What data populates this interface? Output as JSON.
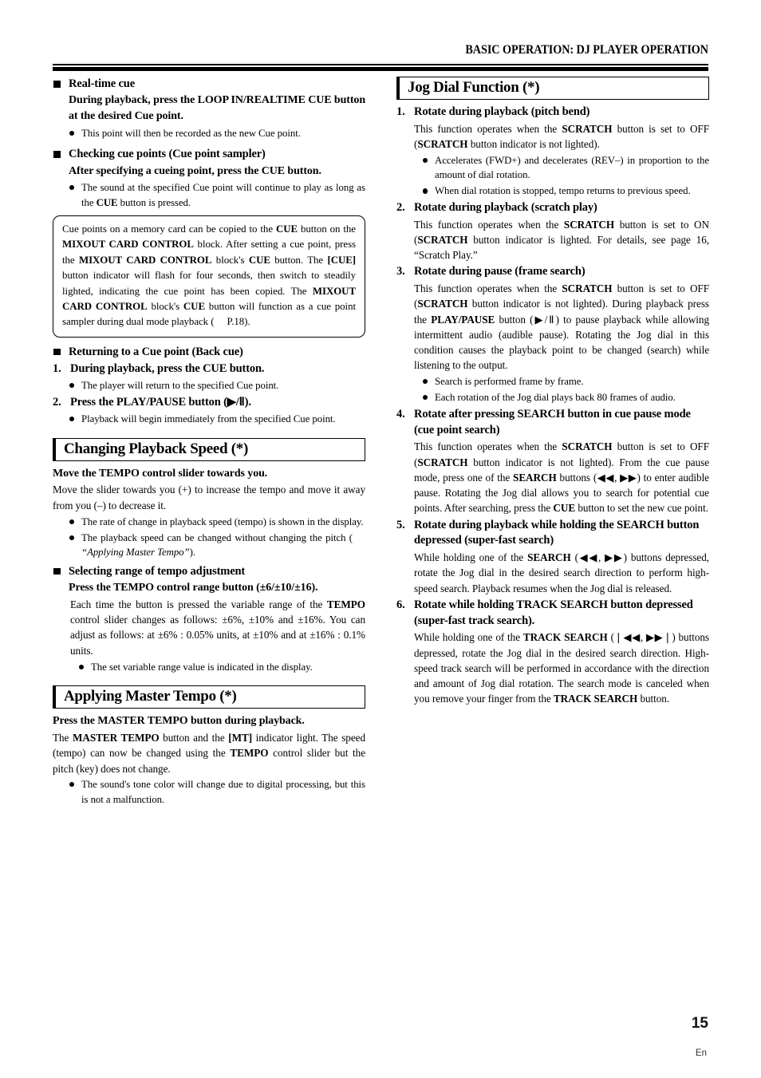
{
  "header": {
    "title": "BASIC OPERATION: DJ PLAYER OPERATION"
  },
  "footer": {
    "page_number": "15",
    "language": "En"
  },
  "left_column": {
    "realtime_cue": {
      "heading": "Real-time cue",
      "instruction_part1": "During playback, press the ",
      "instruction_bold": "LOOP IN/REALTIME CUE",
      "instruction_part2": " button at the desired Cue point.",
      "bullet1": "This point will then be recorded as the new Cue point."
    },
    "checking_cue_points": {
      "heading": "Checking cue points (Cue point sampler)",
      "instruction": "After specifying a cueing point, press the CUE button.",
      "bullet1_part1": "The sound at the specified Cue point will continue to play as long as the ",
      "bullet1_bold": "CUE",
      "bullet1_part2": " button is pressed."
    },
    "note": {
      "t1": "Cue points on a memory card can be copied to the ",
      "b1": "CUE",
      "t2": " button on the ",
      "b2": "MIXOUT CARD CONTROL",
      "t3": " block. After setting a cue point, press the ",
      "b3": "MIXOUT CARD CONTROL",
      "t4": " block's ",
      "b4": "CUE",
      "t5": " button. The ",
      "b5": "[CUE]",
      "t6": " button indicator will flash for four seconds, then switch to steadily lighted, indicating the cue point has been copied. The ",
      "b6": "MIXOUT CARD CONTROL",
      "t7": " block's ",
      "b7": "CUE",
      "t8": " button will function as a cue point sampler during dual mode playback (",
      "t9": "P.18)."
    },
    "back_cue": {
      "heading": "Returning to a Cue point (Back cue)",
      "step1_num": "1.",
      "step1_text": "During playback, press the CUE button.",
      "step1_bullet": "The player will return to the specified Cue point.",
      "step2_num": "2.",
      "step2_text": "Press the PLAY/PAUSE button (▶/Ⅱ).",
      "step2_bullet": "Playback will begin immediately from the specified Cue point."
    },
    "changing_playback_speed": {
      "section_title": "Changing Playback Speed (*)",
      "instruction": "Move the TEMPO control slider towards you.",
      "body": "Move the slider towards you (+) to increase the tempo and move it away from you (–) to decrease it.",
      "bullet1": "The rate of change in playback speed (tempo) is shown in the display.",
      "bullet2_part1": "The playback speed can be changed without changing the pitch (",
      "bullet2_italic": "“Applying Master Tempo”",
      "bullet2_part2": ").",
      "sub_heading": "Selecting range of tempo adjustment",
      "sub_instruction": "Press the TEMPO control range button (±6/±10/±16).",
      "sub_body_part1": "Each time the button is pressed the variable range of the ",
      "sub_body_bold": "TEMPO",
      "sub_body_part2": " control slider changes as follows: ±6%, ±10% and ±16%.  You can adjust as follows: at ±6% : 0.05% units, at ±10% and at ±16% : 0.1% units.",
      "sub_bullet": "The set variable range value is indicated in the display."
    },
    "applying_master_tempo": {
      "section_title": "Applying Master Tempo (*)",
      "instruction": "Press the MASTER TEMPO button during playback.",
      "body_t1": "The ",
      "body_b1": "MASTER TEMPO",
      "body_t2": " button and the ",
      "body_b2": "[MT]",
      "body_t3": " indicator light. The speed (tempo) can now be changed using the ",
      "body_b3": "TEMPO",
      "body_t4": " control slider but the pitch (key) does not change.",
      "bullet1": "The sound's tone color will change due to digital processing, but this is not a malfunction."
    }
  },
  "right_column": {
    "section_title": "Jog Dial Function (*)",
    "items": [
      {
        "num": "1.",
        "heading": "Rotate during playback (pitch bend)",
        "body_t1": "This function operates when the ",
        "body_b1": "SCRATCH",
        "body_t2": " button is set to OFF (",
        "body_b2": "SCRATCH",
        "body_t3": " button indicator is not lighted).",
        "bullets": [
          "Accelerates (FWD+) and decelerates (REV–) in proportion to the amount of dial rotation.",
          "When dial rotation is stopped, tempo returns to previous speed."
        ]
      },
      {
        "num": "2.",
        "heading": "Rotate during playback (scratch play)",
        "body_t1": "This function operates when the ",
        "body_b1": "SCRATCH",
        "body_t2": " button is set to ON (",
        "body_b2": "SCRATCH",
        "body_t3": " button indicator is lighted. For details, see page 16, “Scratch Play.”",
        "bullets": []
      },
      {
        "num": "3.",
        "heading": "Rotate during pause (frame search)",
        "body_t1": "This function operates when the ",
        "body_b1": "SCRATCH",
        "body_t2": " button is set to OFF (",
        "body_b2": "SCRATCH",
        "body_t3": " button indicator is not lighted). During playback press the ",
        "body_b3": "PLAY/PAUSE",
        "body_t4": " button (▶/Ⅱ) to pause playback while allowing intermittent audio (audible pause). Rotating the Jog dial in this condition causes the playback point to be changed (search) while listening to the output.",
        "bullets": [
          "Search is performed frame by frame.",
          "Each rotation of the Jog dial plays back 80 frames of audio."
        ]
      },
      {
        "num": "4.",
        "heading": "Rotate after pressing SEARCH button in cue pause mode (cue point search)",
        "body_t1": "This function operates when the ",
        "body_b1": "SCRATCH",
        "body_t2": " button is set to OFF (",
        "body_b2": "SCRATCH",
        "body_t3": " button indicator is not lighted). From the cue pause mode, press one of the ",
        "body_b3": "SEARCH",
        "body_t4": " buttons (◀◀, ▶▶) to enter audible pause. Rotating the Jog dial allows you to search for potential cue points. After searching, press the ",
        "body_b4": "CUE",
        "body_t5": " button to set the new cue point.",
        "bullets": []
      },
      {
        "num": "5.",
        "heading": "Rotate during playback while holding the SEARCH button depressed  (super-fast search)",
        "body_t1": "While holding one of the ",
        "body_b1": "SEARCH",
        "body_t2": " (◀◀, ▶▶) buttons depressed, rotate the Jog dial in the desired search direction to perform high-speed search. Playback resumes when the Jog dial is released.",
        "bullets": []
      },
      {
        "num": "6.",
        "heading": "Rotate while holding TRACK SEARCH button depressed (super-fast track search).",
        "body_t1": "While holding one of the ",
        "body_b1": "TRACK SEARCH",
        "body_t2": " (❘◀◀, ▶▶❘) buttons depressed, rotate the Jog dial in the desired search direction. High-speed track search will be performed in accordance with the direction and amount of Jog dial rotation. The search mode is canceled when you remove your finger from the ",
        "body_b2": "TRACK SEARCH",
        "body_t3": " button.",
        "bullets": []
      }
    ]
  }
}
